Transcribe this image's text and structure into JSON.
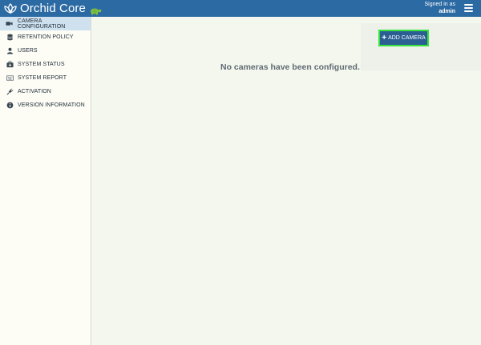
{
  "header": {
    "app_name": "Orchid Core",
    "signed_in_label": "Signed in as",
    "username": "admin",
    "logo_icon": "orchid-flower-icon",
    "turtle_icon": "turtle-icon",
    "menu_icon": "hamburger-menu-icon",
    "bar_color": "#2c6aa3"
  },
  "sidebar": {
    "items": [
      {
        "label": "CAMERA CONFIGURATION",
        "icon": "video-camera-icon",
        "active": true
      },
      {
        "label": "RETENTION POLICY",
        "icon": "database-icon",
        "active": false
      },
      {
        "label": "USERS",
        "icon": "user-icon",
        "active": false
      },
      {
        "label": "SYSTEM STATUS",
        "icon": "medkit-icon",
        "active": false
      },
      {
        "label": "SYSTEM REPORT",
        "icon": "keyboard-icon",
        "active": false
      },
      {
        "label": "ACTIVATION",
        "icon": "plug-icon",
        "active": false
      },
      {
        "label": "VERSION INFORMATION",
        "icon": "info-circle-icon",
        "active": false
      }
    ]
  },
  "main": {
    "add_camera_label": "ADD CAMERA",
    "add_camera_icon": "plus-icon",
    "empty_message": "No cameras have been configured."
  },
  "colors": {
    "accent": "#2b5f93",
    "highlight": "#36e33a",
    "active_nav": "#cfe1ef"
  }
}
